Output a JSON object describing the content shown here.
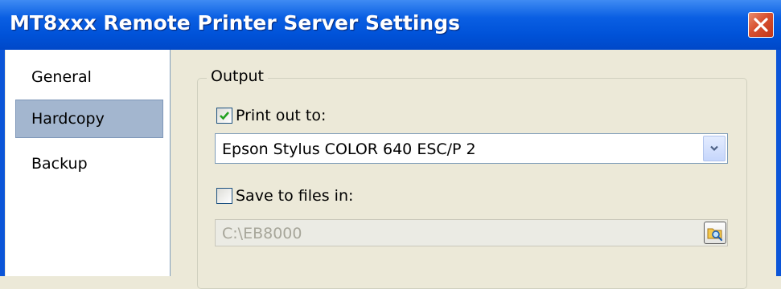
{
  "window": {
    "title": "MT8xxx Remote Printer Server Settings",
    "accent_color": "#0a5fe3",
    "close_icon": "close-icon"
  },
  "sidebar": {
    "items": [
      {
        "label": "General",
        "selected": false
      },
      {
        "label": "Hardcopy",
        "selected": true
      },
      {
        "label": "Backup",
        "selected": false
      }
    ]
  },
  "output": {
    "group_label": "Output",
    "print_out": {
      "label": "Print out to:",
      "checked": true
    },
    "printer": {
      "selected": "Epson Stylus COLOR 640 ESC/P 2"
    },
    "save_files": {
      "label": "Save to files in:",
      "checked": false
    },
    "path": {
      "value": "C:\\EB8000",
      "enabled": false,
      "browse_icon": "folder-browse-icon"
    }
  }
}
